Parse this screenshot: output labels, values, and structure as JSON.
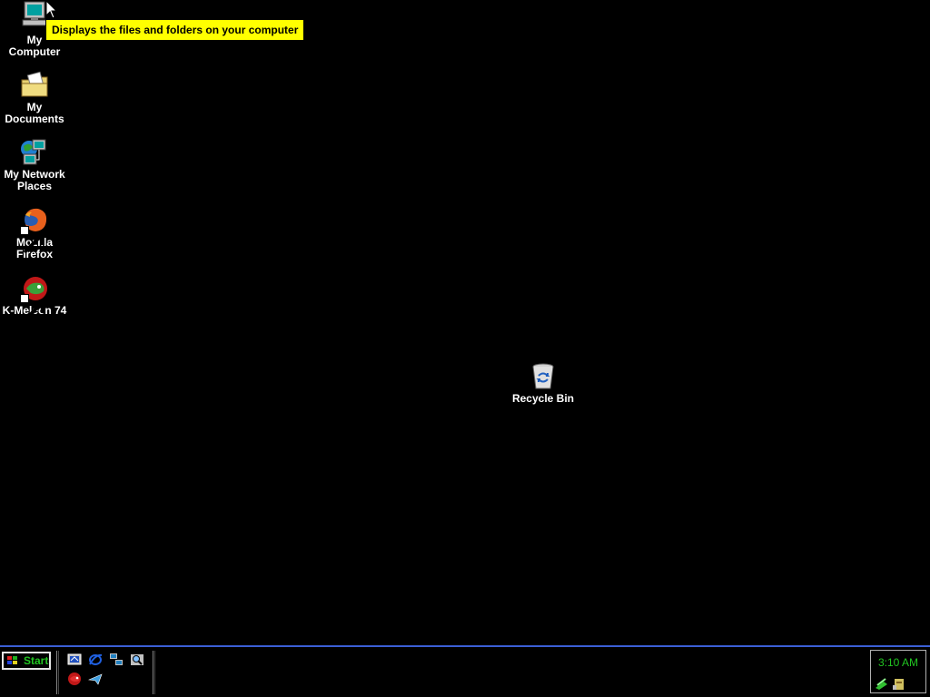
{
  "desktop": {
    "icons": [
      {
        "label": "My\nComputer",
        "icon": "my-computer-icon"
      },
      {
        "label": "My\nDocuments",
        "icon": "my-documents-icon"
      },
      {
        "label": "My Network\nPlaces",
        "icon": "network-places-icon"
      },
      {
        "label": "Mozilla\nFirefox",
        "icon": "firefox-icon"
      },
      {
        "label": "K-Meleon 74",
        "icon": "k-meleon-icon"
      },
      {
        "label": "Recycle Bin",
        "icon": "recycle-bin-icon"
      }
    ],
    "tooltip": "Displays the files and folders on your computer"
  },
  "taskbar": {
    "start_label": "Start",
    "clock": "3:10 AM",
    "quick_launch": [
      "desktop-icon",
      "ie-icon",
      "network-icon",
      "search-icon",
      "k-meleon-icon",
      "messenger-icon"
    ],
    "tray": [
      "network-status-icon",
      "printer-icon"
    ]
  },
  "colors": {
    "background": "#000000",
    "tooltip_bg": "#ffff00",
    "accent_green": "#21c521",
    "taskbar_border": "#3b5fd6"
  }
}
